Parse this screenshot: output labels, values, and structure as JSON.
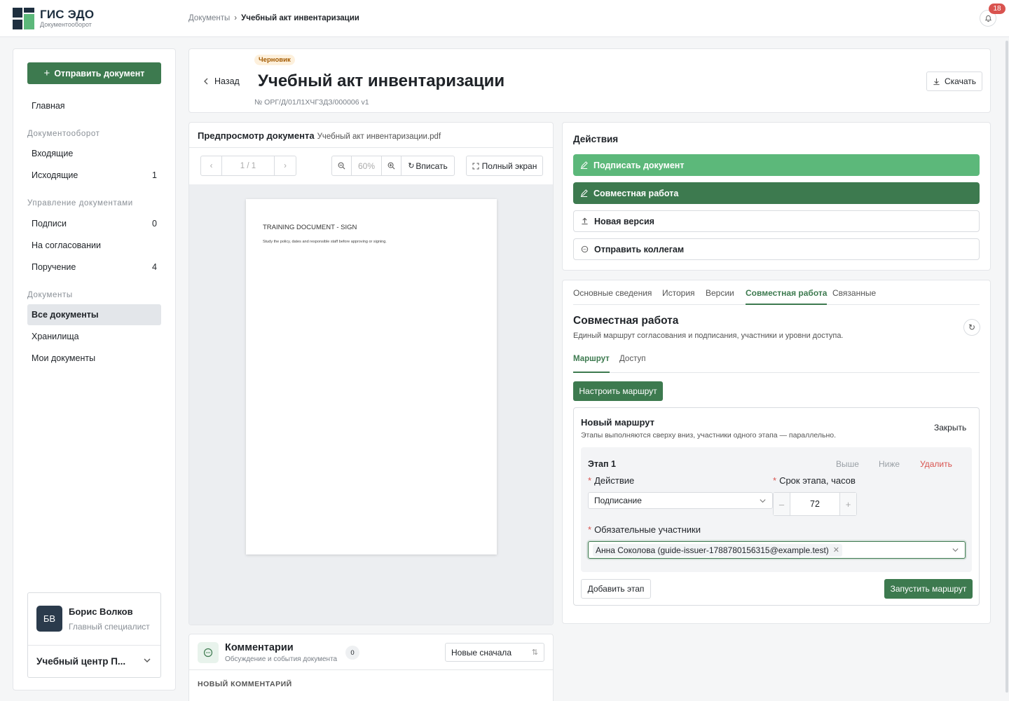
{
  "header": {
    "brand_name": "ГИС ЭДО",
    "brand_sub": "Документооборот",
    "breadcrumb": [
      "Документы",
      "Учебный акт инвентаризации"
    ],
    "breadcrumb_sep": "›",
    "notifications_count": "18"
  },
  "sidebar": {
    "send_button": "Отправить документ",
    "home": "Главная",
    "groups": {
      "workflow": "Документооборот",
      "management": "Управление документами",
      "documents": "Документы"
    },
    "items": {
      "incoming": {
        "label": "Входящие",
        "count": ""
      },
      "outgoing": {
        "label": "Исходящие",
        "count": "1"
      },
      "signatures": {
        "label": "Подписи",
        "count": "0"
      },
      "approval": {
        "label": "На согласовании",
        "count": ""
      },
      "assignment": {
        "label": "Поручение",
        "count": "4"
      },
      "all_docs": {
        "label": "Все документы",
        "count": ""
      },
      "storage": {
        "label": "Хранилища",
        "count": ""
      },
      "my_docs": {
        "label": "Мои документы",
        "count": ""
      }
    },
    "user": {
      "initials": "БВ",
      "name": "Борис Волков",
      "role": "Главный специалист",
      "org": "Учебный центр П..."
    }
  },
  "document": {
    "back": "Назад",
    "status": "Черновик",
    "title": "Учебный акт инвентаризации",
    "number": "№ ОРГ/Д/01Л1ХЧГЗДЗ/000006  v1",
    "download": "Скачать"
  },
  "preview": {
    "title": "Предпросмотр документа",
    "filename": "Учебный акт инвентаризации.pdf",
    "page_indicator": "1 / 1",
    "zoom": "60%",
    "fit": "Вписать",
    "fullscreen": "Полный экран",
    "page_heading": "TRAINING DOCUMENT - SIGN",
    "page_text": "Study the policy, dates and responsible staff before approving or signing."
  },
  "comments": {
    "title": "Комментарии",
    "subtitle": "Обсуждение и события документа",
    "count": "0",
    "sort": "Новые сначала",
    "new_label": "НОВЫЙ КОММЕНТАРИЙ"
  },
  "actions": {
    "title": "Действия",
    "sign": "Подписать документ",
    "collab": "Совместная работа",
    "new_version": "Новая версия",
    "send_colleagues": "Отправить коллегам"
  },
  "tabs": {
    "items": [
      "Основные сведения",
      "История",
      "Версии",
      "Совместная работа",
      "Связанные"
    ],
    "active": "Совместная работа"
  },
  "collab": {
    "title": "Совместная работа",
    "subtitle": "Единый маршрут согласования и подписания, участники и уровни доступа.",
    "subtabs": [
      "Маршрут",
      "Доступ"
    ],
    "configure": "Настроить маршрут",
    "route": {
      "title": "Новый маршрут",
      "subtitle": "Этапы выполняются сверху вниз, участники одного этапа — параллельно.",
      "close": "Закрыть",
      "stage": {
        "title": "Этап 1",
        "up": "Выше",
        "down": "Ниже",
        "delete": "Удалить",
        "action_label": "Действие",
        "action_value": "Подписание",
        "deadline_label": "Срок этапа, часов",
        "deadline_value": "72",
        "participants_label": "Обязательные участники",
        "participant": "Анна Соколова (guide-issuer-1788780156315@example.test)"
      },
      "add_stage": "Добавить этап",
      "launch": "Запустить маршрут"
    }
  },
  "colors": {
    "accent": "#3d7a4f",
    "accent_light": "#5cb87a",
    "danger": "#d9534f",
    "brand_dark": "#1e2f3f"
  }
}
